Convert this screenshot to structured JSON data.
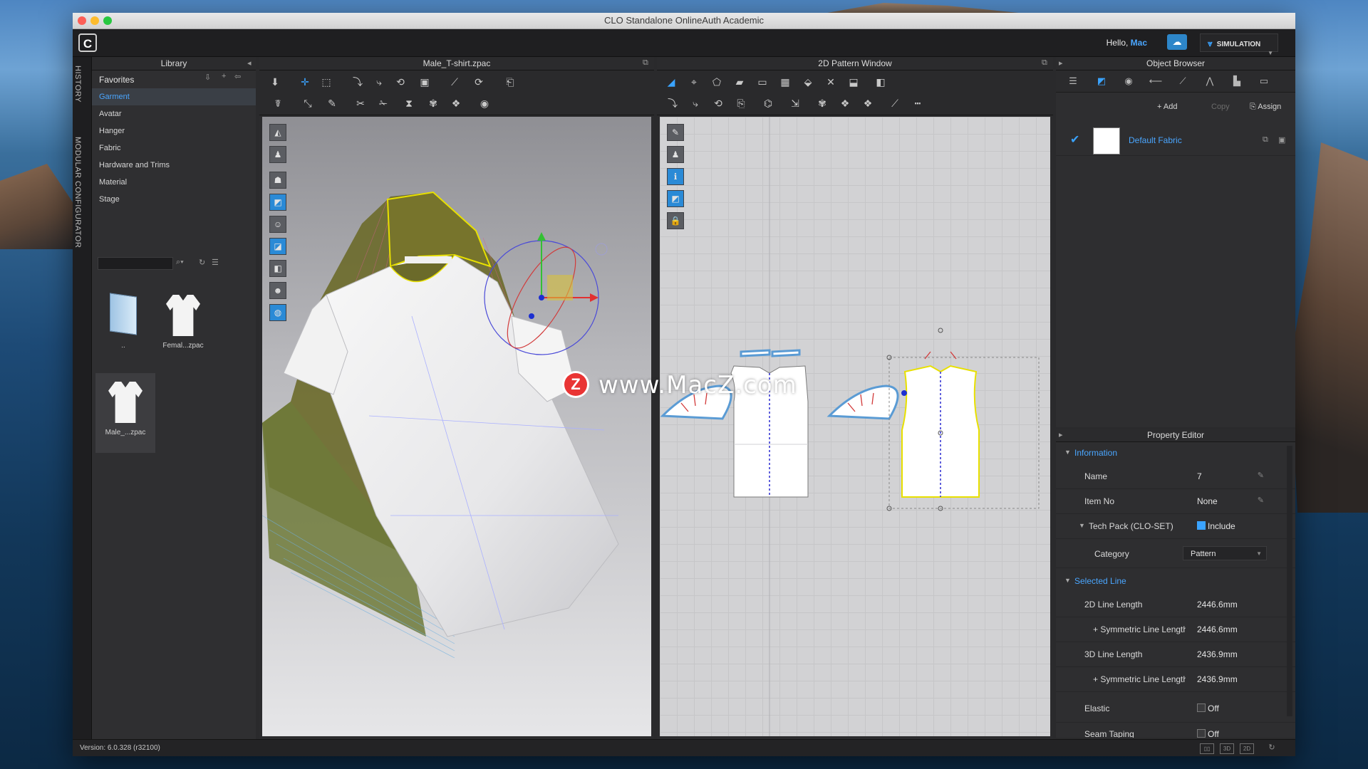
{
  "window": {
    "title": "CLO Standalone OnlineAuth Academic"
  },
  "appbar": {
    "logo": "C",
    "hello_prefix": "Hello, ",
    "user": "Mac",
    "mode": "SIMULATION",
    "cloud_icon": "cloud-icon"
  },
  "side_tabs": [
    "HISTORY",
    "MODULAR CONFIGURATOR"
  ],
  "library": {
    "title": "Library",
    "favorites": "Favorites",
    "items": [
      "Garment",
      "Avatar",
      "Hanger",
      "Fabric",
      "Hardware and Trims",
      "Material",
      "Stage"
    ],
    "selected": "Garment",
    "thumbs": [
      {
        "label": "..",
        "icon": "folder-icon"
      },
      {
        "label": "Femal...zpac",
        "icon": "shirt-icon"
      },
      {
        "label": "Male_...zpac",
        "icon": "shirt-icon"
      }
    ]
  },
  "viewport3d": {
    "title": "Male_T-shirt.zpac"
  },
  "viewport2d": {
    "title": "2D Pattern Window"
  },
  "watermark": {
    "text": "www.MacZ.com",
    "badge": "Z"
  },
  "object_browser": {
    "title": "Object Browser",
    "actions": {
      "add": "+ Add",
      "copy": "Copy",
      "assign": "Assign"
    },
    "fabric_name": "Default Fabric"
  },
  "property_editor": {
    "title": "Property Editor",
    "information": {
      "label": "Information",
      "name_label": "Name",
      "name_value": "7",
      "item_no_label": "Item No",
      "item_no_value": "None",
      "tech_pack_label": "Tech Pack (CLO-SET)",
      "tech_pack_value": "Include",
      "category_label": "Category",
      "category_value": "Pattern"
    },
    "selected_line": {
      "label": "Selected Line",
      "rows": [
        {
          "k": "2D Line Length",
          "v": "2446.6mm"
        },
        {
          "k": "+ Symmetric Line Length",
          "v": "2446.6mm"
        },
        {
          "k": "3D Line Length",
          "v": "2436.9mm"
        },
        {
          "k": "+ Symmetric Line Length",
          "v": "2436.9mm"
        }
      ],
      "elastic_label": "Elastic",
      "elastic_value": "Off",
      "seam_label": "Seam Taping",
      "seam_value": "Off"
    }
  },
  "status": {
    "version": "Version: 6.0.328 (r32100)"
  },
  "colors": {
    "accent": "#3aa3ff",
    "link": "#4aa6ff",
    "bg": "#2a2a2c",
    "outline": "#e8e000"
  }
}
